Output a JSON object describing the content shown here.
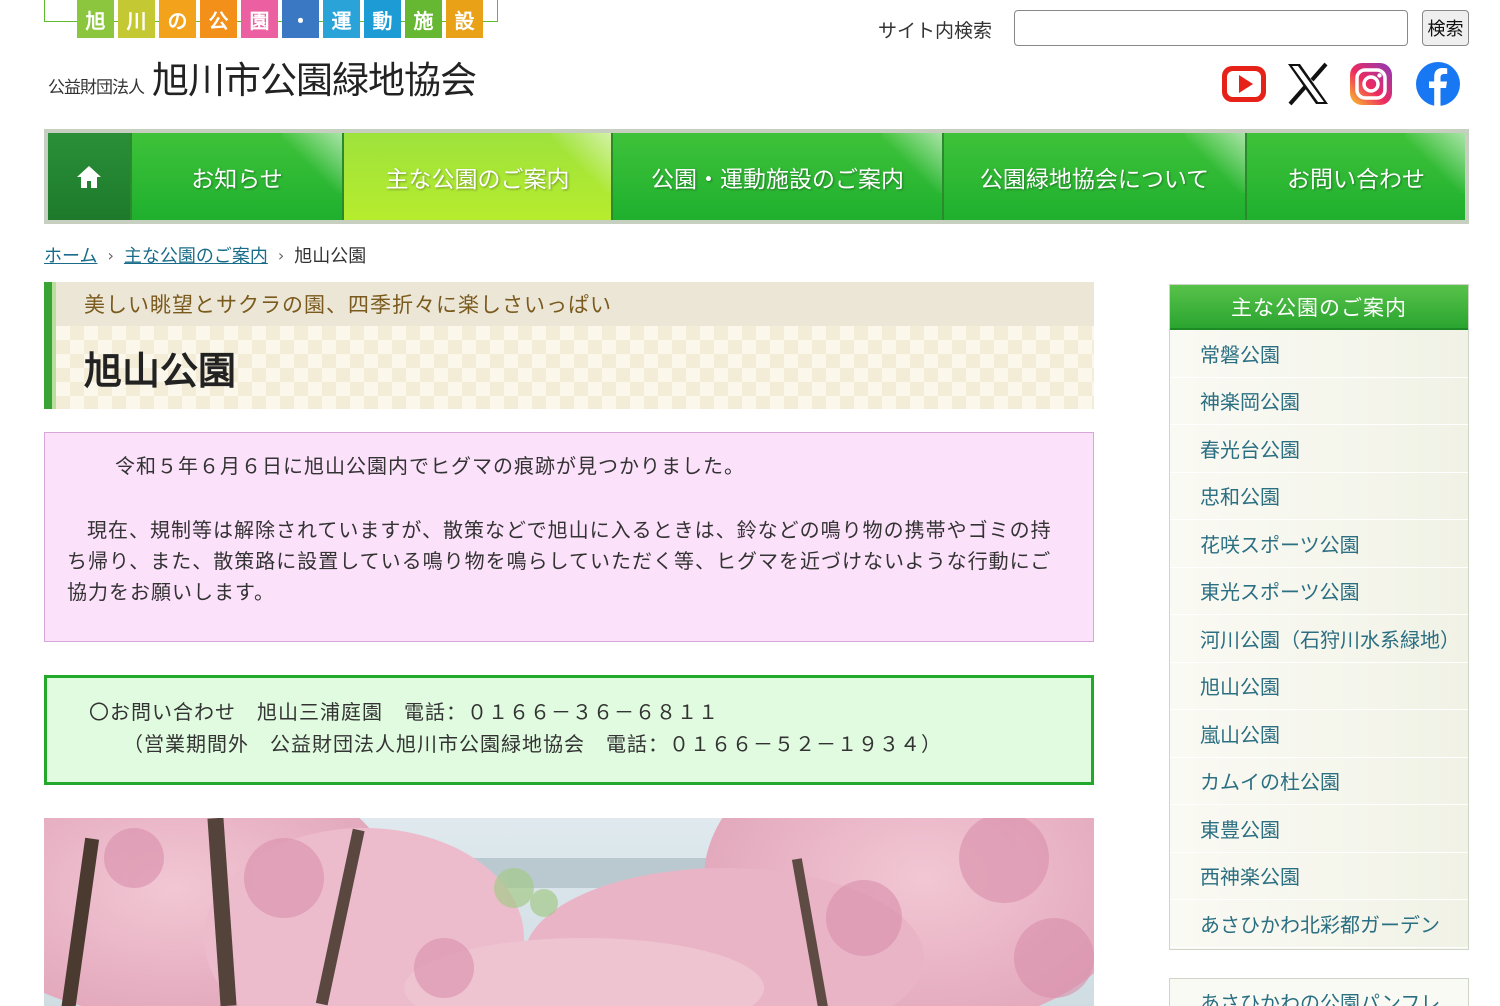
{
  "header": {
    "logo_tiles": [
      {
        "char": "旭",
        "color": "#8cc63f"
      },
      {
        "char": "川",
        "color": "#c4c832"
      },
      {
        "char": "の",
        "color": "#f3a31b"
      },
      {
        "char": "公",
        "color": "#f29019"
      },
      {
        "char": "園",
        "color": "#ec5fa0"
      },
      {
        "char": "・",
        "color": "#3b78c3"
      },
      {
        "char": "運",
        "color": "#2aa3d9"
      },
      {
        "char": "動",
        "color": "#1c9bd4"
      },
      {
        "char": "施",
        "color": "#66b832"
      },
      {
        "char": "設",
        "color": "#e9a118"
      }
    ],
    "org_prefix": "公益財団法人",
    "org_name": "旭川市公園緑地協会",
    "search_label": "サイト内検索",
    "search_value": "",
    "search_button": "検索",
    "social_icons": [
      "youtube-icon",
      "x-icon",
      "instagram-icon",
      "facebook-icon"
    ]
  },
  "nav": {
    "home_icon": "home-icon",
    "items": [
      {
        "label": "お知らせ"
      },
      {
        "label": "主な公園のご案内",
        "active": true
      },
      {
        "label": "公園・運動施設のご案内"
      },
      {
        "label": "公園緑地協会について"
      },
      {
        "label": "お問い合わせ"
      }
    ]
  },
  "breadcrumb": {
    "home": "ホーム",
    "parent": "主な公園のご案内",
    "current": "旭山公園"
  },
  "page": {
    "tagline": "美しい眺望とサクラの園、四季折々に楽しさいっぱい",
    "title": "旭山公園"
  },
  "notice": {
    "line1": "令和５年６月６日に旭山公園内でヒグマの痕跡が見つかりました。",
    "line2": "現在、規制等は解除されていますが、散策などで旭山に入るときは、鈴などの鳴り物の携帯やゴミの持ち帰り、また、散策路に設置している鳴り物を鳴らしていただく等、ヒグマを近づけないような行動にご協力をお願いします。"
  },
  "contact": {
    "line1": "〇お問い合わせ　旭山三浦庭園　電話：０１６６－３６－６８１１",
    "line2": "（営業期間外　公益財団法人旭川市公園緑地協会　電話：０１６６－５２－１９３４）"
  },
  "photo": {
    "subject": "cherry-blossom-photo"
  },
  "sidebar": {
    "title": "主な公園のご案内",
    "items": [
      "常磐公園",
      "神楽岡公園",
      "春光台公園",
      "忠和公園",
      "花咲スポーツ公園",
      "東光スポーツ公園",
      "河川公園（石狩川水系緑地）",
      "旭山公園",
      "嵐山公園",
      "カムイの杜公園",
      "東豊公園",
      "西神楽公園",
      "あさひかわ北彩都ガーデン"
    ],
    "next_box_label": "あさひかわの公園パンフレ"
  }
}
